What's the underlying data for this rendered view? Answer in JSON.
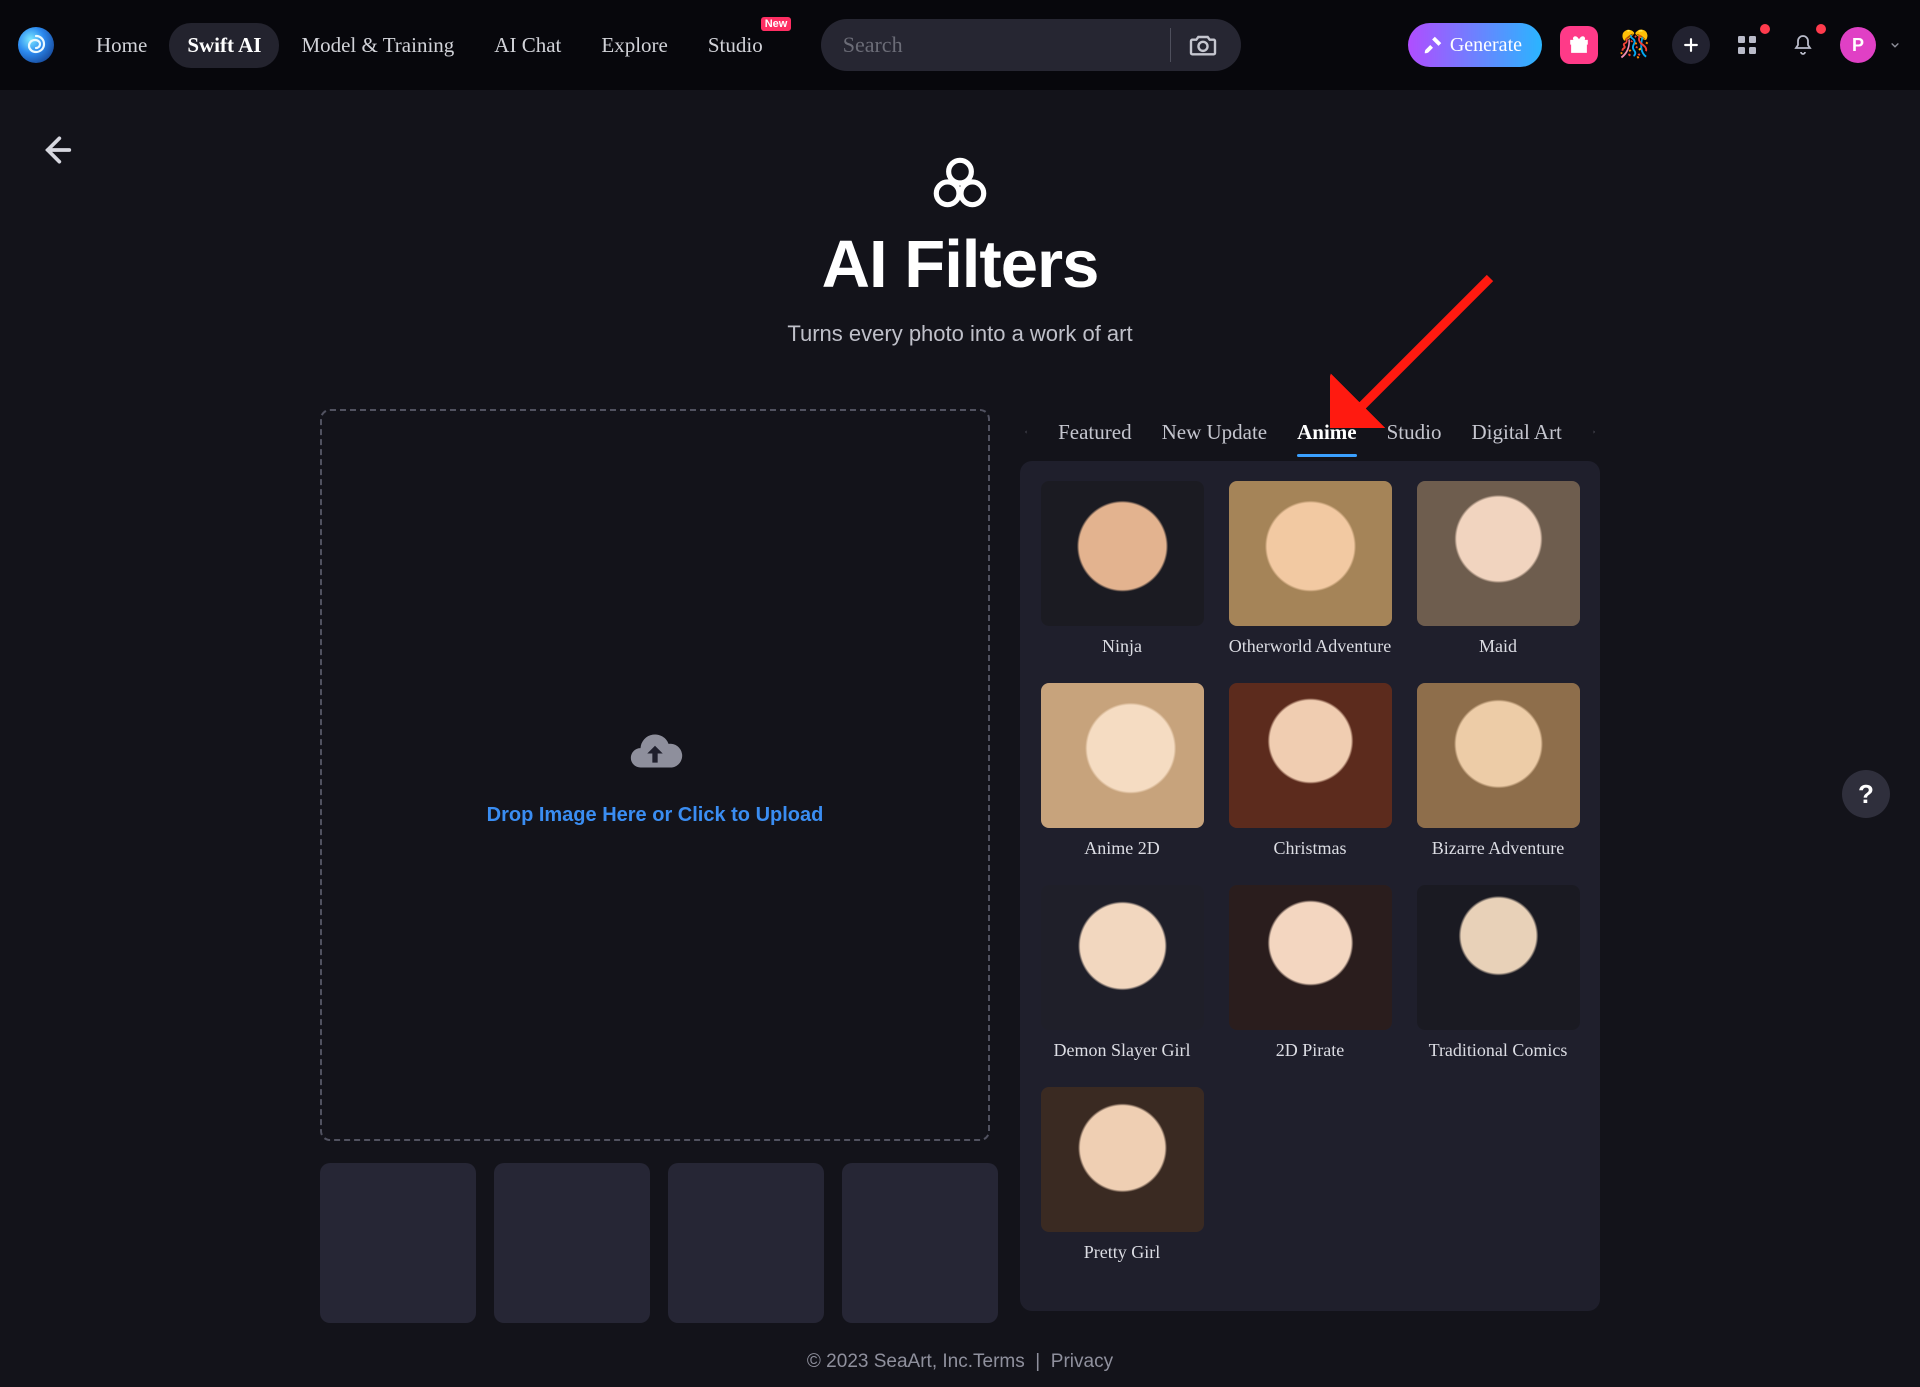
{
  "header": {
    "nav": [
      {
        "label": "Home",
        "active": false
      },
      {
        "label": "Swift AI",
        "active": true
      },
      {
        "label": "Model & Training",
        "active": false
      },
      {
        "label": "AI Chat",
        "active": false
      },
      {
        "label": "Explore",
        "active": false
      },
      {
        "label": "Studio",
        "active": false,
        "badge": "New"
      }
    ],
    "search_placeholder": "Search",
    "generate_label": "Generate",
    "avatar_letter": "P"
  },
  "page": {
    "title": "AI Filters",
    "subtitle": "Turns every photo into a work of art",
    "drop_text": "Drop Image Here or Click to Upload"
  },
  "tabs": [
    {
      "label": "Featured",
      "active": false
    },
    {
      "label": "New Update",
      "active": false
    },
    {
      "label": "Anime",
      "active": true
    },
    {
      "label": "Studio",
      "active": false
    },
    {
      "label": "Digital Art",
      "active": false
    }
  ],
  "filters": [
    {
      "name": "Ninja"
    },
    {
      "name": "Otherworld Adventure"
    },
    {
      "name": "Maid"
    },
    {
      "name": "Anime 2D"
    },
    {
      "name": "Christmas"
    },
    {
      "name": "Bizarre Adventure"
    },
    {
      "name": "Demon Slayer Girl"
    },
    {
      "name": "2D Pirate"
    },
    {
      "name": "Traditional Comics"
    },
    {
      "name": "Pretty Girl"
    }
  ],
  "help": "?",
  "footer": {
    "copyright": "© 2023 SeaArt, Inc.",
    "terms": "Terms",
    "sep": "|",
    "privacy": "Privacy"
  },
  "colors": {
    "accent": "#3aa0ff",
    "annotation": "#ff1a10"
  }
}
